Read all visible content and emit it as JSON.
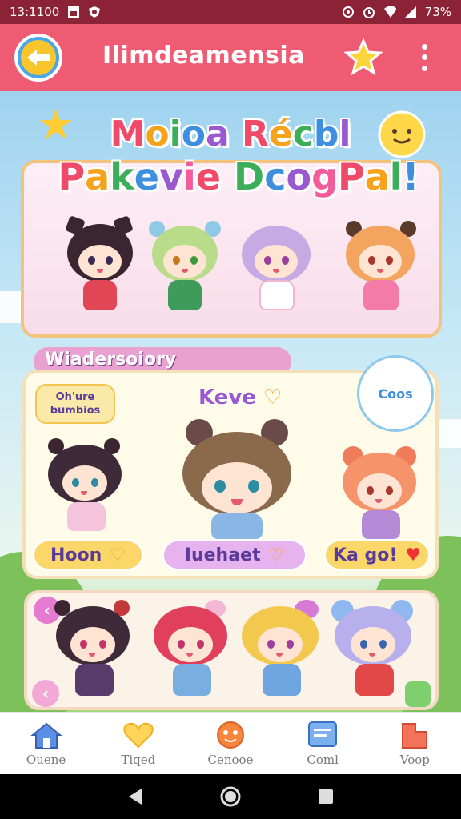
{
  "status_bar": {
    "time": "13:1100",
    "battery": "73%",
    "icons_left": [
      "image-icon",
      "shield-icon"
    ],
    "icons_right": [
      "location-icon",
      "alarm-icon",
      "wifi-icon",
      "signal-icon"
    ]
  },
  "app_bar": {
    "title": "Ilimdeamensia",
    "back_icon": "back-arrow-icon",
    "favorite_icon": "star-icon",
    "menu_icon": "more-vert-icon"
  },
  "banner": {
    "line1": [
      "M",
      "o",
      "i",
      "o",
      "a",
      " ",
      "R",
      "é",
      "c",
      "b",
      "l"
    ],
    "line2": [
      "P",
      "a",
      "k",
      "e",
      "v",
      "i",
      "e",
      " ",
      "D",
      "c",
      "o",
      "g",
      "P",
      "a",
      "l",
      "!"
    ],
    "colors": [
      "#ef4a6a",
      "#f7a21b",
      "#3cae5a",
      "#3f8fe0",
      "#9b59d0",
      "#f35b9b"
    ]
  },
  "section": {
    "title": "Wiadersoiory"
  },
  "featured": {
    "badge_left": "Oh'ure\nbumbios",
    "center_label": "Keve",
    "bubble_right": "Coos",
    "pills": [
      {
        "label": "Hoon",
        "heart": "♡",
        "bg": "#fbd76a",
        "color": "#5a3b9a"
      },
      {
        "label": "Iuehaet",
        "heart": "♡",
        "bg": "#e6b3ee",
        "color": "#5a3b9a"
      },
      {
        "label": "Ka go!",
        "heart": "♥",
        "bg": "#fbd76a",
        "color": "#5a3b9a"
      }
    ]
  },
  "bottom_nav": [
    {
      "label": "Ouene",
      "icon": "home-icon"
    },
    {
      "label": "Tiqed",
      "icon": "heart-icon"
    },
    {
      "label": "Cenooe",
      "icon": "face-icon"
    },
    {
      "label": "Coml",
      "icon": "chat-icon"
    },
    {
      "label": "Voop",
      "icon": "bookmark-icon"
    }
  ],
  "system_nav": [
    "back-triangle-icon",
    "home-circle-icon",
    "recents-square-icon"
  ]
}
